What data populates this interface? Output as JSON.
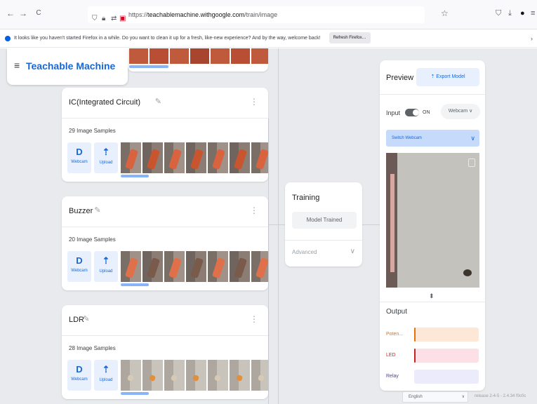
{
  "browser": {
    "back_icon": "←",
    "forward_icon": "→",
    "reload_icon": "C",
    "url_prefix": "https://",
    "url_host": "teachablemachine.withgoogle.com",
    "url_path": "/train/image",
    "icons": [
      "shield-icon",
      "lock-icon",
      "permissions-icon",
      "record-icon",
      "star-icon",
      "pocket-icon",
      "download-icon",
      "account-icon",
      "menu-icon"
    ]
  },
  "notification": {
    "message": "It looks like you haven't started Firefox in a while. Do you want to clean it up for a fresh, like-new experience? And by the way, welcome back!",
    "button": "Refresh Firefox…",
    "close": "›"
  },
  "app": {
    "menu_icon": "≡",
    "title": "Teachable Machine"
  },
  "classes": [
    {
      "name": "IC(Integrated Circuit)",
      "samples": "29 Image Samples",
      "thumb_color": "#d9623f",
      "thumb_color_alt": "#c9552f"
    },
    {
      "name": "Buzzer",
      "samples": "20 Image Samples",
      "thumb_color": "#e0704a",
      "thumb_color_alt": "#7a5a4a"
    },
    {
      "name": "LDR",
      "samples": "28 Image Samples",
      "thumb_color": "#d8c9b5",
      "thumb_color_alt": "#e0903c"
    }
  ],
  "sample_tools": {
    "webcam_label": "Webcam",
    "upload_label": "Upload",
    "webcam_icon": "D",
    "upload_icon": "⇡"
  },
  "training": {
    "title": "Training",
    "button": "Model Trained",
    "advanced": "Advanced",
    "chevron": "∨"
  },
  "preview": {
    "title": "Preview",
    "export_button": "Export Model",
    "export_icon": "⇡",
    "input_label": "Input",
    "toggle_state": "ON",
    "source": "Webcam",
    "source_chevron": "∨",
    "switch_webcam": "Switch Webcam",
    "switch_chevron": "∨",
    "output_label": "Output",
    "drag_icon": "⬍",
    "outputs": [
      {
        "name": "Poten...",
        "color": "#e8710a",
        "bg": "#fde8d7",
        "confidence": 0.01
      },
      {
        "name": "LED",
        "color": "#c5221f",
        "bg": "#fce0e6",
        "confidence": 0.01
      },
      {
        "name": "Relay",
        "color": "#5e35b1",
        "bg": "#ecebfb",
        "confidence": 0
      }
    ]
  },
  "footer": {
    "language": "English",
    "release": "release 2-4-5 - 2.4.34 f0c0c"
  }
}
